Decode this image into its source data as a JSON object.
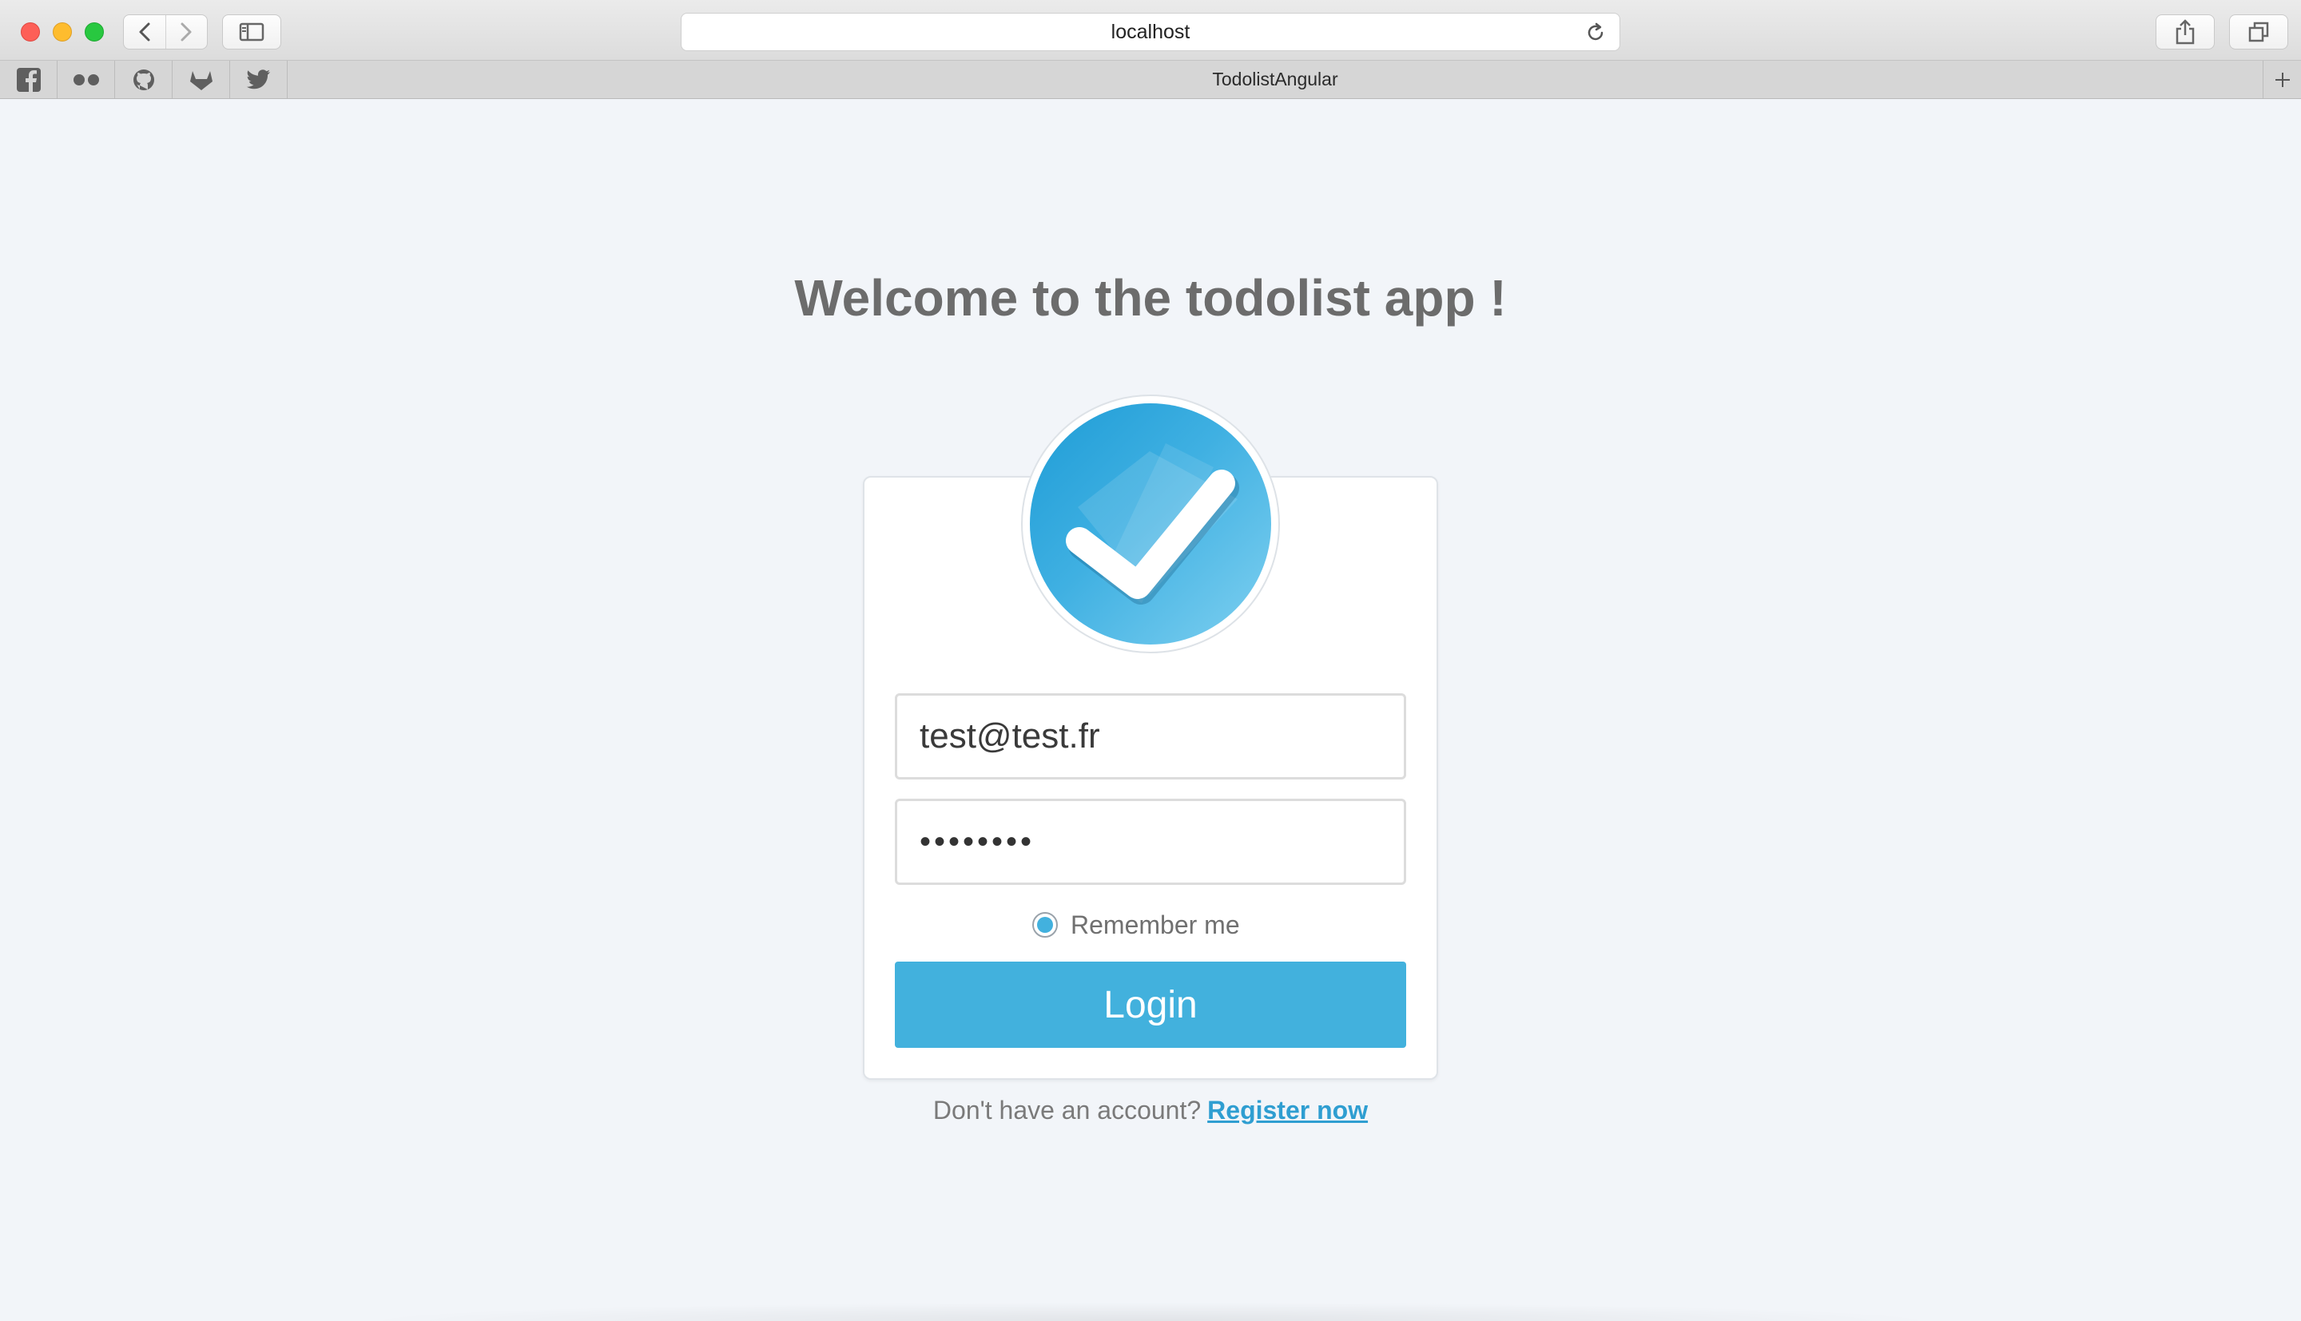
{
  "browser": {
    "url": "localhost",
    "tab_title": "TodolistAngular",
    "bookmarks": [
      "facebook-icon",
      "flickr-icon",
      "github-icon",
      "gitlab-icon",
      "twitter-icon"
    ]
  },
  "page": {
    "heading": "Welcome to the todolist app !",
    "email_value": "test@test.fr",
    "password_value": "••••••••",
    "remember_label": "Remember me",
    "remember_checked": true,
    "login_label": "Login",
    "register_prompt": "Don't have an account?",
    "register_link": "Register now"
  },
  "colors": {
    "accent": "#42b1dd",
    "link": "#2f9ed1",
    "background": "#f2f5f9",
    "heading": "#6c6c6c"
  }
}
